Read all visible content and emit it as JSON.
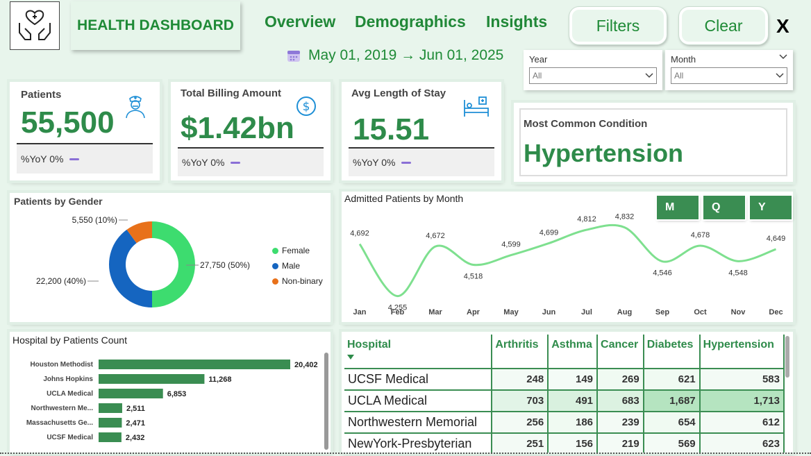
{
  "header": {
    "title": "HEALTH DASHBOARD",
    "nav": [
      "Overview",
      "Demographics",
      "Insights"
    ],
    "filters_label": "Filters",
    "clear_label": "Clear",
    "close_label": "X",
    "date_range": "May 01, 2019 → Jun 01, 2025",
    "icons": {
      "logo": "hands-heart-icon",
      "date": "calendar-icon"
    }
  },
  "slicers": {
    "year": {
      "label": "Year",
      "value": "All"
    },
    "month": {
      "label": "Month",
      "value": "All"
    }
  },
  "kpis": [
    {
      "title": "Patients",
      "value": "55,500",
      "foot": "%YoY 0%",
      "icon": "nurse-icon"
    },
    {
      "title": "Total Billing Amount",
      "value": "$1.42bn",
      "foot": "%YoY 0%",
      "icon": "dollar-icon"
    },
    {
      "title": "Avg Length of Stay",
      "value": "15.51",
      "foot": "%YoY 0%",
      "icon": "hospital-bed-icon"
    }
  ],
  "condition": {
    "title": "Most Common Condition",
    "value": "Hypertension"
  },
  "colors": {
    "accent": "#2e8b4a",
    "female": "#3ddc6f",
    "male": "#1565c0",
    "nonbinary": "#e8711a",
    "line": "#7ee08f",
    "bar": "#3a8d52"
  },
  "chart_data": [
    {
      "type": "pie",
      "title": "Patients by Gender",
      "categories": [
        "Female",
        "Male",
        "Non-binary"
      ],
      "values": [
        27750,
        22200,
        5550
      ],
      "data_labels": [
        "27,750 (50%)",
        "22,200 (40%)",
        "5,550 (10%)"
      ],
      "legend": "right",
      "donut": true
    },
    {
      "type": "line",
      "title": "Admitted Patients by Month",
      "categories": [
        "Jan",
        "Feb",
        "Mar",
        "Apr",
        "May",
        "Jun",
        "Jul",
        "Aug",
        "Sep",
        "Oct",
        "Nov",
        "Dec"
      ],
      "values": [
        4692,
        4255,
        4672,
        4518,
        4599,
        4699,
        4812,
        4832,
        4546,
        4678,
        4548,
        4649
      ],
      "data_labels": [
        "4,692",
        "4,255",
        "4,672",
        "4,518",
        "4,599",
        "4,699",
        "4,812",
        "4,832",
        "4,546",
        "4,678",
        "4,548",
        "4,649"
      ],
      "grid": false
    },
    {
      "type": "bar",
      "orientation": "horizontal",
      "title": "Hospital by Patients Count",
      "categories": [
        "Houston Methodist",
        "Johns Hopkins",
        "UCLA Medical",
        "Northwestern Me...",
        "Massachusetts Ge...",
        "UCSF Medical"
      ],
      "values": [
        20402,
        11268,
        6853,
        2511,
        2471,
        2432
      ],
      "data_labels": [
        "20,402",
        "11,268",
        "6,853",
        "2,511",
        "2,471",
        "2,432"
      ]
    }
  ],
  "granularity": [
    "M",
    "Q",
    "Y"
  ],
  "matrix": {
    "columns": [
      "Hospital",
      "Arthritis",
      "Asthma",
      "Cancer",
      "Diabetes",
      "Hypertension"
    ],
    "rows": [
      {
        "name": "UCSF Medical",
        "values": [
          "248",
          "149",
          "269",
          "621",
          "583"
        ]
      },
      {
        "name": "UCLA Medical",
        "values": [
          "703",
          "491",
          "683",
          "1,687",
          "1,713"
        ]
      },
      {
        "name": "Northwestern Memorial",
        "values": [
          "256",
          "186",
          "239",
          "654",
          "612"
        ]
      },
      {
        "name": "NewYork-Presbyterian",
        "values": [
          "251",
          "156",
          "219",
          "569",
          "623"
        ]
      }
    ],
    "heat": [
      [
        0.02,
        0.0,
        0.05,
        0.05,
        0.02
      ],
      [
        0.25,
        0.4,
        0.35,
        0.95,
        0.95
      ],
      [
        0.02,
        0.05,
        0.02,
        0.05,
        0.02
      ],
      [
        0.02,
        0.0,
        0.0,
        0.0,
        0.02
      ]
    ]
  }
}
